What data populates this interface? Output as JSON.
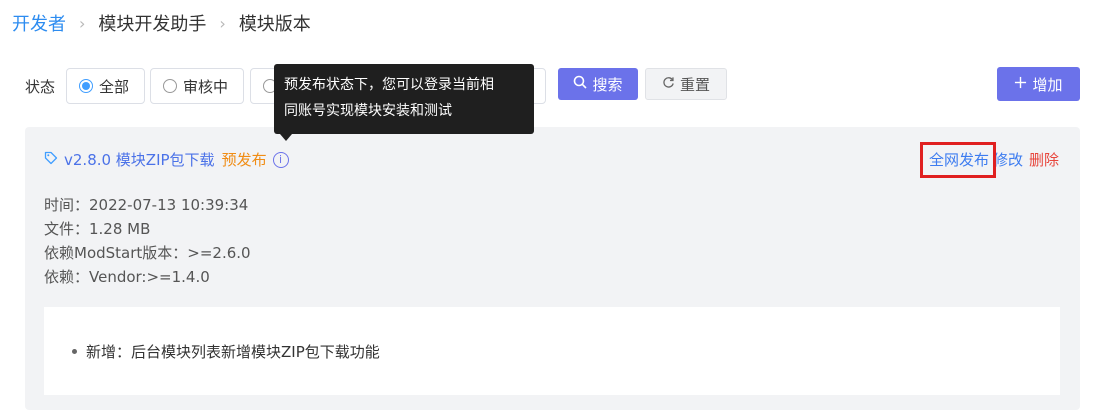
{
  "breadcrumb": {
    "root": "开发者",
    "items": [
      "模块开发助手",
      "模块版本"
    ],
    "separator": "›"
  },
  "filter": {
    "label": "状态",
    "options": [
      {
        "label": "全部",
        "checked": true
      },
      {
        "label": "审核中",
        "checked": false
      },
      {
        "label": "",
        "checked": false
      }
    ]
  },
  "toolbar": {
    "search_label": "搜索",
    "reset_label": "重置",
    "add_label": "增加",
    "search_icon": "search-icon",
    "reset_icon": "refresh-icon",
    "add_icon": "plus-icon"
  },
  "tooltip": {
    "line1": "预发布状态下，您可以登录当前相",
    "line2": "同账号实现模块安装和测试"
  },
  "version": {
    "title": "v2.8.0 模块ZIP包下载",
    "status": "预发布",
    "actions": {
      "publish": "全网发布",
      "edit": "修改",
      "delete": "删除"
    },
    "meta": [
      "时间：2022-07-13 10:39:34",
      "文件：1.28 MB",
      "依赖ModStart版本：>=2.6.0",
      "依赖：Vendor:>=1.4.0"
    ],
    "notes": [
      "新增：后台模块列表新增模块ZIP包下载功能"
    ]
  },
  "colors": {
    "primary": "#6b72ea",
    "link": "#3d7cf0",
    "warning": "#f08c14",
    "danger": "#e8453c",
    "highlight": "#e02020"
  }
}
